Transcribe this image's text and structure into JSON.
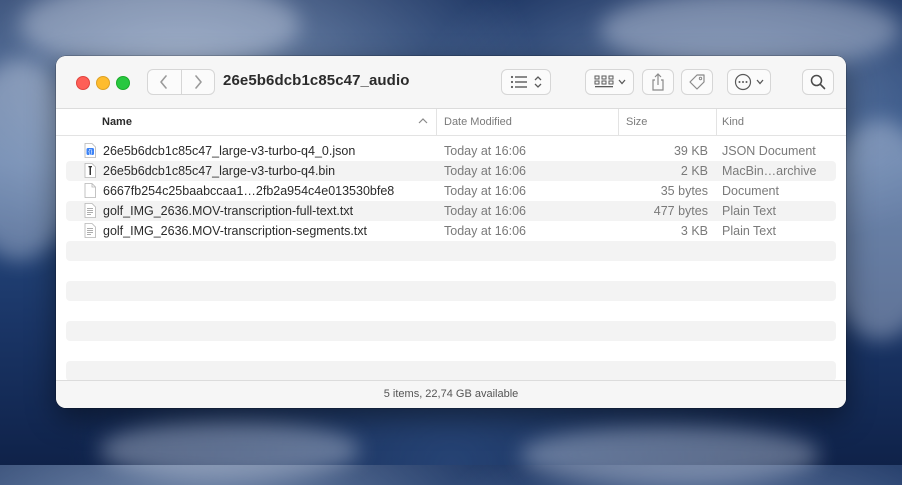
{
  "window": {
    "title": "26e5b6dcb1c85c47_audio",
    "toolbar": {
      "back_icon": "chevron-left-icon",
      "forward_icon": "chevron-right-icon",
      "list_view_icon": "list-view-icon",
      "grid_view_icon": "grid-view-icon",
      "share_icon": "share-icon",
      "tag_icon": "tag-icon",
      "more_icon": "ellipsis-circle-icon",
      "search_icon": "search-icon"
    }
  },
  "columns": {
    "name": "Name",
    "date": "Date Modified",
    "size": "Size",
    "kind": "Kind"
  },
  "files": [
    {
      "name": "26e5b6dcb1c85c47_large-v3-turbo-q4_0.json",
      "date": "Today at 16:06",
      "size": "39 KB",
      "kind": "JSON Document",
      "icon": "json-file-icon"
    },
    {
      "name": "26e5b6dcb1c85c47_large-v3-turbo-q4.bin",
      "date": "Today at 16:06",
      "size": "2 KB",
      "kind": "MacBin…archive",
      "icon": "binary-file-icon"
    },
    {
      "name": "6667fb254c25baabccaa1…2fb2a954c4e013530bfe8",
      "date": "Today at 16:06",
      "size": "35 bytes",
      "kind": "Document",
      "icon": "document-icon"
    },
    {
      "name": "golf_IMG_2636.MOV-transcription-full-text.txt",
      "date": "Today at 16:06",
      "size": "477 bytes",
      "kind": "Plain Text",
      "icon": "text-file-icon"
    },
    {
      "name": "golf_IMG_2636.MOV-transcription-segments.txt",
      "date": "Today at 16:06",
      "size": "3 KB",
      "kind": "Plain Text",
      "icon": "text-file-icon"
    }
  ],
  "status": "5 items, 22,74 GB available"
}
